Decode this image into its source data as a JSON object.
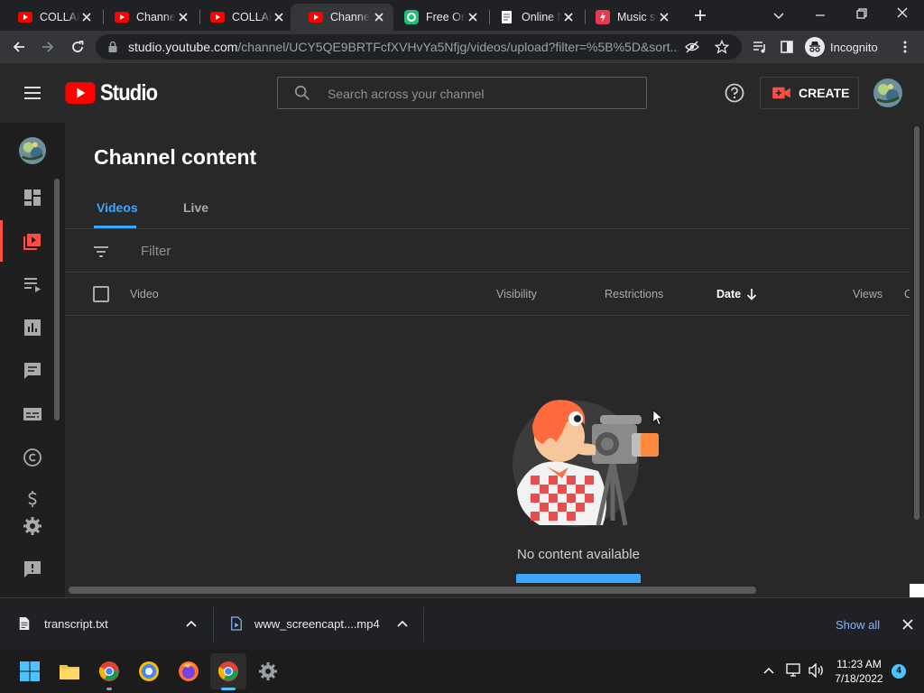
{
  "browser": {
    "tabs": [
      {
        "title": "COLLAB",
        "favicon": "youtube-icon"
      },
      {
        "title": "Channel content - YouTube Studio",
        "favicon": "youtube-studio-icon"
      },
      {
        "title": "COLLAB",
        "favicon": "youtube-icon"
      },
      {
        "title": "Channel content",
        "favicon": "youtube-studio-icon"
      },
      {
        "title": "Free Online",
        "favicon": "green-app-icon"
      },
      {
        "title": "Online Notepad",
        "favicon": "notepad-icon"
      },
      {
        "title": "Music sync",
        "favicon": "music-app-icon"
      }
    ],
    "url_host": "studio.youtube.com",
    "url_path": "/channel/UCY5QE9BRTFcfXVHvYa5Nfjg/videos/upload?filter=%5B%5D&sort...",
    "profile_label": "Incognito"
  },
  "studio": {
    "logo_text": "Studio",
    "search_placeholder": "Search across your channel",
    "create_label": "CREATE"
  },
  "main": {
    "title": "Channel content",
    "tabs": [
      "Videos",
      "Live"
    ],
    "filter_placeholder": "Filter",
    "columns": {
      "video": "Video",
      "visibility": "Visibility",
      "restrictions": "Restrictions",
      "date": "Date",
      "views": "Views",
      "comments": "C"
    },
    "empty_message": "No content available"
  },
  "downloads": {
    "items": [
      {
        "name": "transcript.txt"
      },
      {
        "name": "www_screencapt....mp4"
      }
    ],
    "show_all": "Show all"
  },
  "taskbar": {
    "time": "11:23 AM",
    "date": "7/18/2022",
    "notifications": "4"
  },
  "colors": {
    "accent_blue": "#3ea6ff",
    "youtube_red": "#ff0000",
    "active_red": "#ff4e45"
  }
}
